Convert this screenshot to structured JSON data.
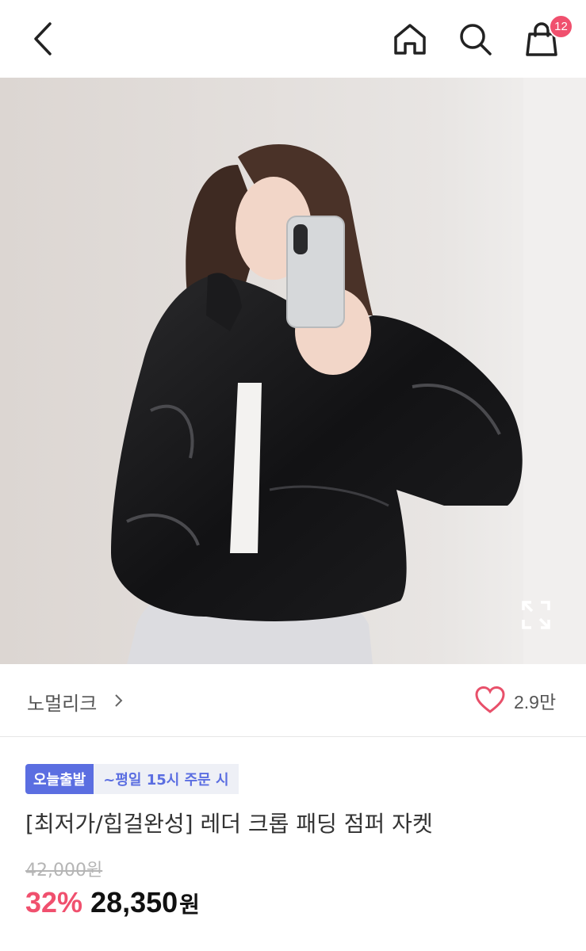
{
  "header": {
    "cart_count": "12"
  },
  "colors": {
    "badge_red": "#f0506e",
    "discount_red": "#f0506e",
    "heart_red": "#e8506a",
    "ship_badge_bg": "#5b6ee1",
    "ship_text_color": "#5b6ee1"
  },
  "icons": [
    "back-arrow-icon",
    "home-icon",
    "search-icon",
    "shopping-bag-icon",
    "expand-icon",
    "chevron-right-icon",
    "heart-icon"
  ],
  "gallery": {
    "image_count": 4,
    "active_index": 0
  },
  "product": {
    "brand": "노멀리크",
    "likes": "2.9만",
    "shipping_badge": "오늘출발",
    "shipping_text": "~평일 15시 주문 시",
    "title": "[최저가/힙걸완성] 레더 크롭 패딩 점퍼 자켓",
    "original_price": "42,000원",
    "discount": "32%",
    "price": "28,350",
    "currency": "원"
  }
}
